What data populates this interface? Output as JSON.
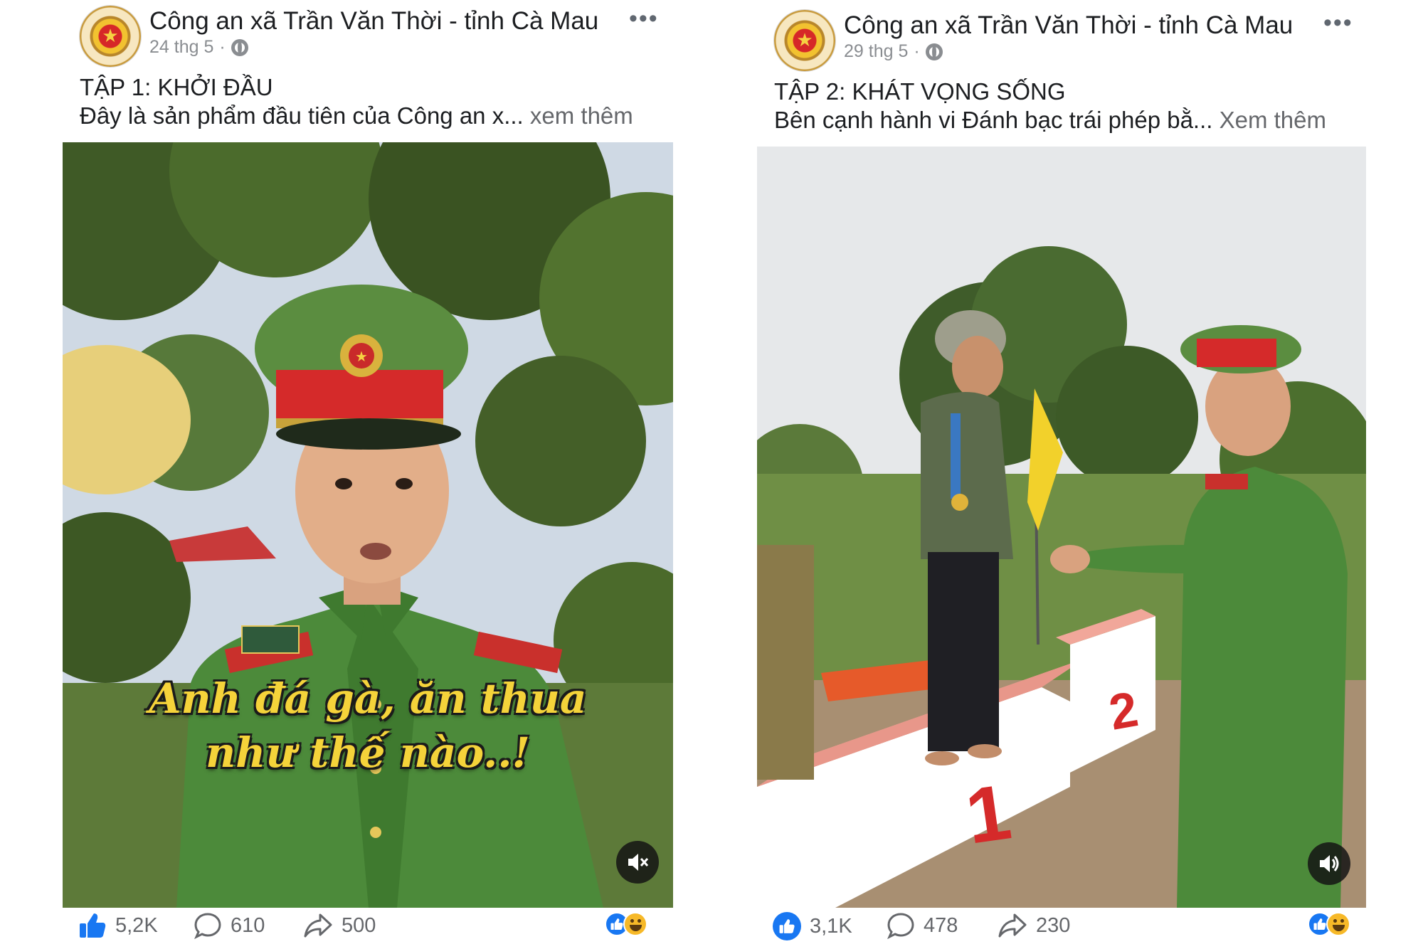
{
  "colors": {
    "facebook_blue": "#1877f2",
    "meta_gray": "#8a8d91",
    "text_dark": "#1c1e21",
    "caption_yellow": "#f5d33a",
    "uniform_green": "#4c8a3a",
    "cap_red": "#d52a2a"
  },
  "posts": [
    {
      "page_name": "Công an xã Trần Văn Thời - tỉnh Cà Mau",
      "date": "24 thg 5",
      "separator": "·",
      "title": "TẬP 1: KHỞI ĐẦU",
      "description": "Đây là sản phẩm đầu tiên của Công an x...",
      "see_more": "xem thêm",
      "video_caption_line1": "Anh đá gà, ăn thua",
      "video_caption_line2": "như thế nào..!",
      "sound_icon": "muted-speaker-icon",
      "likes": "5,2K",
      "comments": "610",
      "shares": "500"
    },
    {
      "page_name": "Công an xã Trần Văn Thời - tỉnh Cà Mau",
      "date": "29 thg 5",
      "separator": "·",
      "title": "TẬP 2: KHÁT VỌNG SỐNG",
      "description": "Bên cạnh hành vi Đánh bạc trái phép bằ...",
      "see_more": "Xem thêm",
      "podium_label_1": "1",
      "podium_label_2": "2",
      "sound_icon": "speaker-icon",
      "likes": "3,1K",
      "comments": "478",
      "shares": "230"
    }
  ]
}
